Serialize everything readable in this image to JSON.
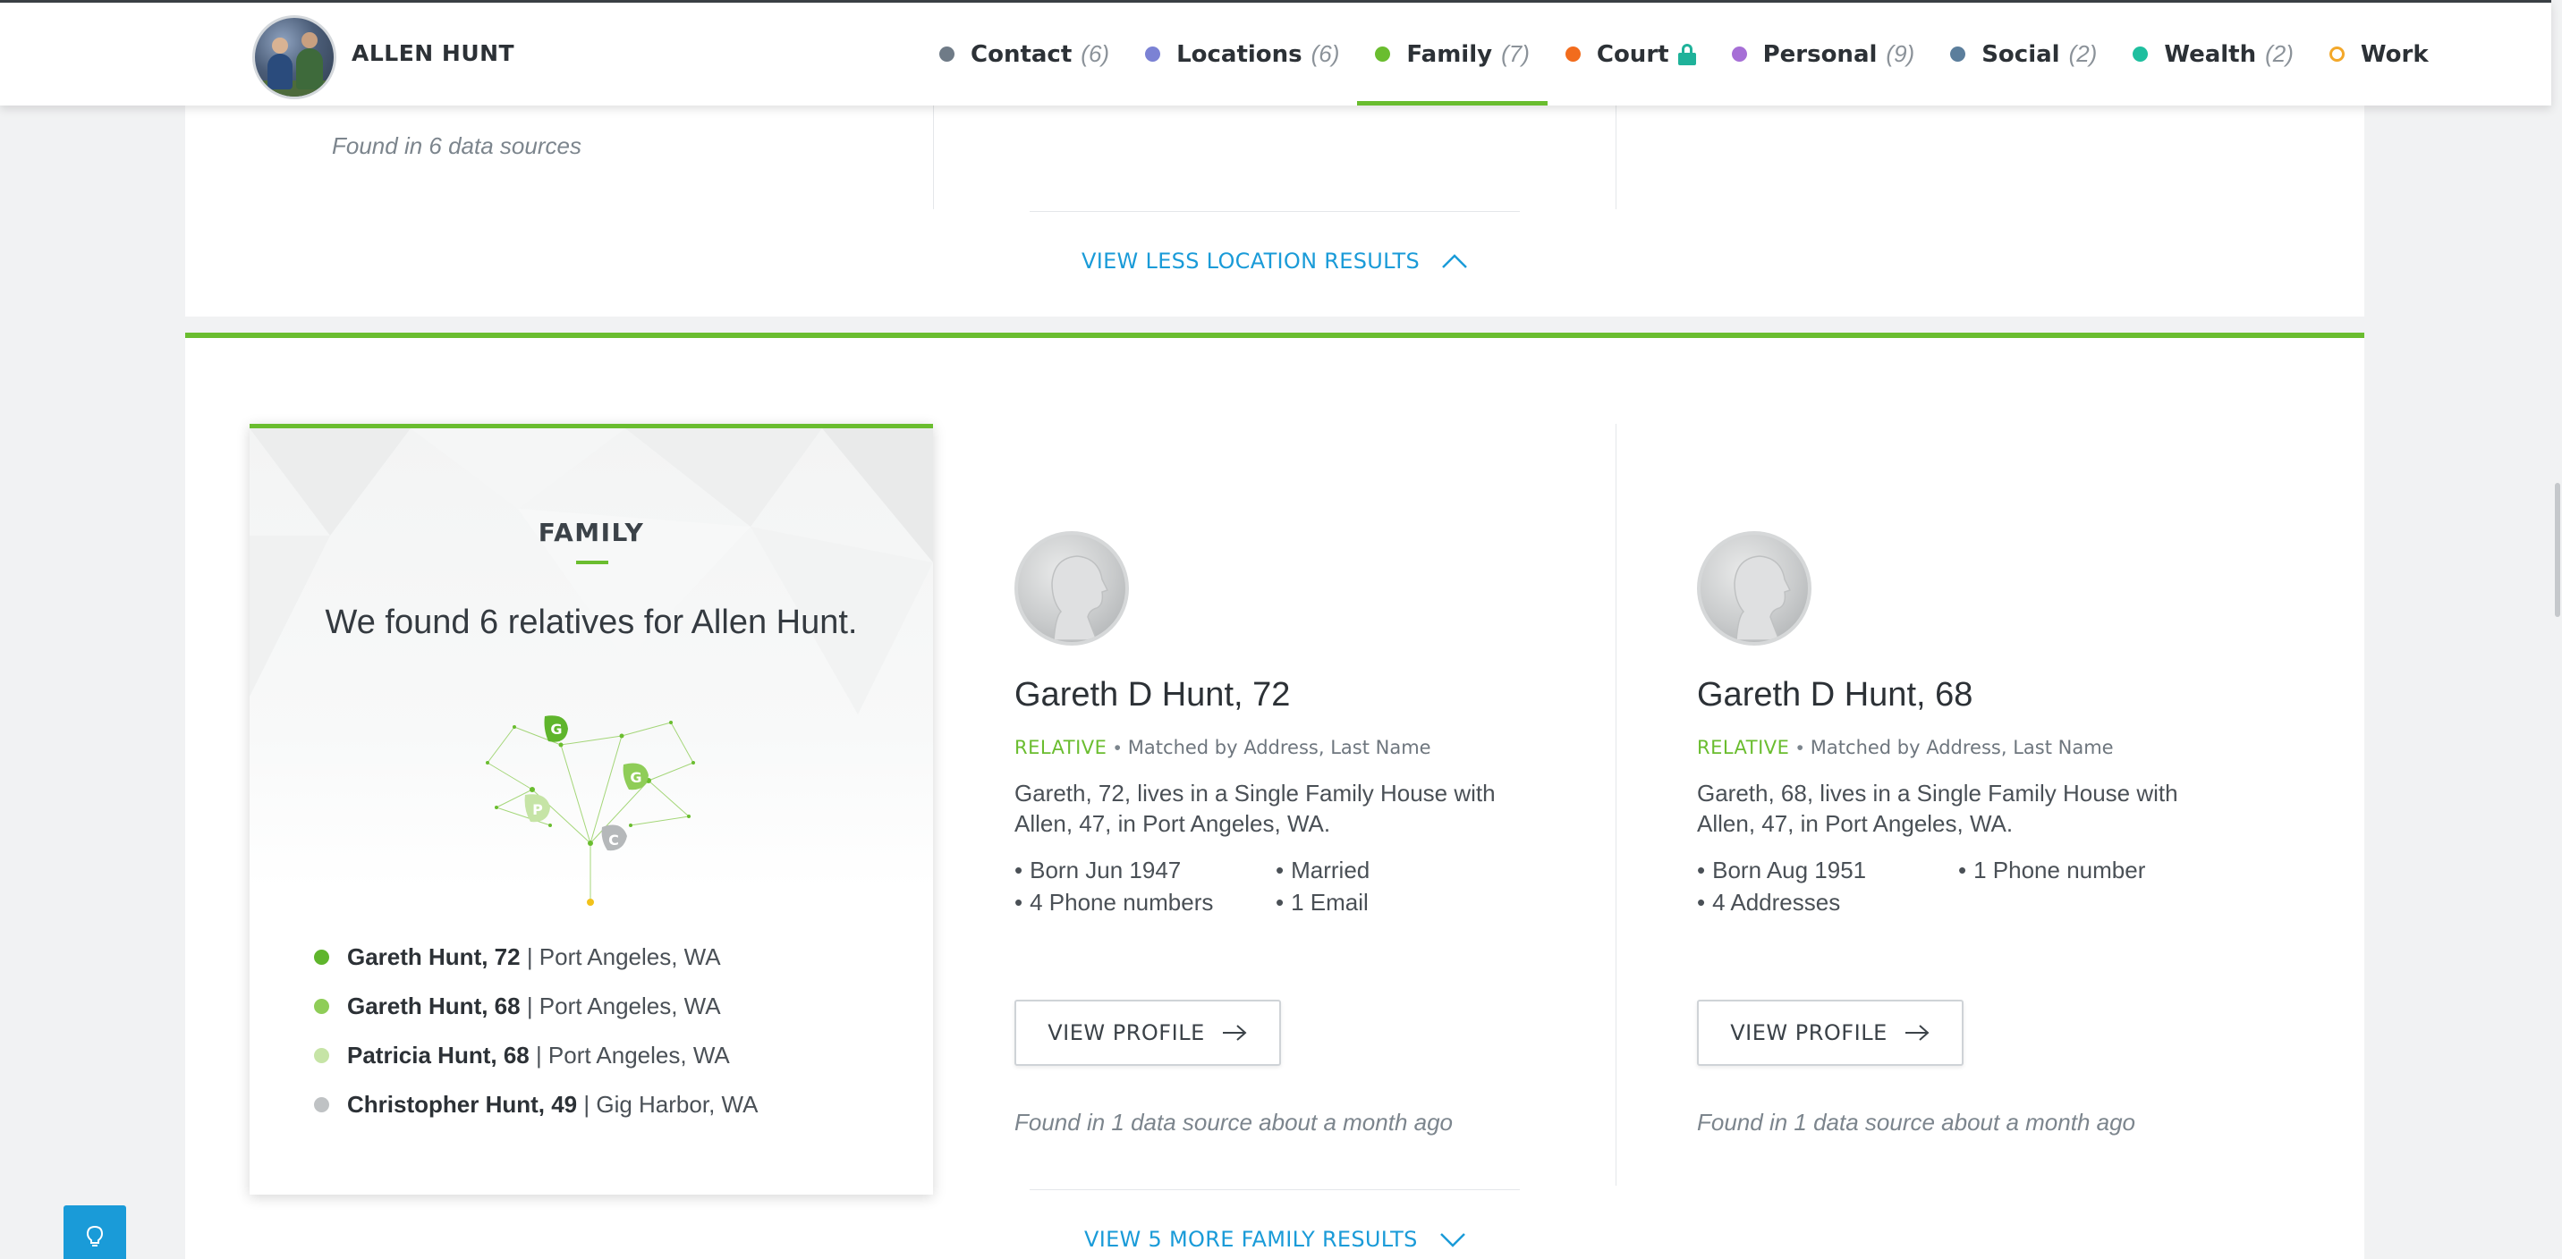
{
  "header": {
    "name": "ALLEN HUNT",
    "nav": [
      {
        "label": "Contact",
        "count": "(6)",
        "color": "#6f7b87",
        "active": false
      },
      {
        "label": "Locations",
        "count": "(6)",
        "color": "#7b82d4",
        "active": false
      },
      {
        "label": "Family",
        "count": "(7)",
        "color": "#6abd2f",
        "active": true
      },
      {
        "label": "Court",
        "count": "",
        "color": "#f26c1d",
        "active": false,
        "locked": true
      },
      {
        "label": "Personal",
        "count": "(9)",
        "color": "#a66fd6",
        "active": false
      },
      {
        "label": "Social",
        "count": "(2)",
        "color": "#5b7e9c",
        "active": false
      },
      {
        "label": "Wealth",
        "count": "(2)",
        "color": "#1fbf9f",
        "active": false
      },
      {
        "label": "Work",
        "count": "",
        "color": "#f3a82a",
        "active": false,
        "hollow": true
      }
    ]
  },
  "locations": {
    "found_text": "Found in 6 data sources",
    "view_less_label": "VIEW LESS LOCATION RESULTS"
  },
  "family": {
    "title": "FAMILY",
    "summary": "We found 6 relatives for Allen Hunt.",
    "tree_letters": [
      "G",
      "G",
      "P",
      "C"
    ],
    "relatives": [
      {
        "name": "Gareth Hunt, 72",
        "location": " | Port Angeles, WA",
        "color": "#5fb52c"
      },
      {
        "name": "Gareth Hunt, 68",
        "location": " | Port Angeles, WA",
        "color": "#8fcd58"
      },
      {
        "name": "Patricia Hunt, 68",
        "location": " | Port Angeles, WA",
        "color": "#c6e4a6"
      },
      {
        "name": "Christopher Hunt, 49",
        "location": " | Gig Harbor, WA",
        "color": "#bfc2c4"
      }
    ],
    "people": [
      {
        "name": "Gareth D Hunt, 72",
        "relation": "RELATIVE",
        "matched": "Matched by Address, Last Name",
        "description": "Gareth, 72, lives in a Single Family House with Allen, 47, in Port Angeles, WA.",
        "facts": [
          "Born Jun 1947",
          "Married",
          "4 Phone numbers",
          "1 Email"
        ],
        "button": "VIEW PROFILE",
        "found": "Found in 1 data source about a month ago"
      },
      {
        "name": "Gareth D Hunt, 68",
        "relation": "RELATIVE",
        "matched": "Matched by Address, Last Name",
        "description": "Gareth, 68, lives in a Single Family House with Allen, 47, in Port Angeles, WA.",
        "facts": [
          "Born Aug 1951",
          "1 Phone number",
          "4 Addresses"
        ],
        "button": "VIEW PROFILE",
        "found": "Found in 1 data source about a month ago"
      }
    ],
    "view_more_label": "VIEW 5 MORE FAMILY RESULTS"
  }
}
